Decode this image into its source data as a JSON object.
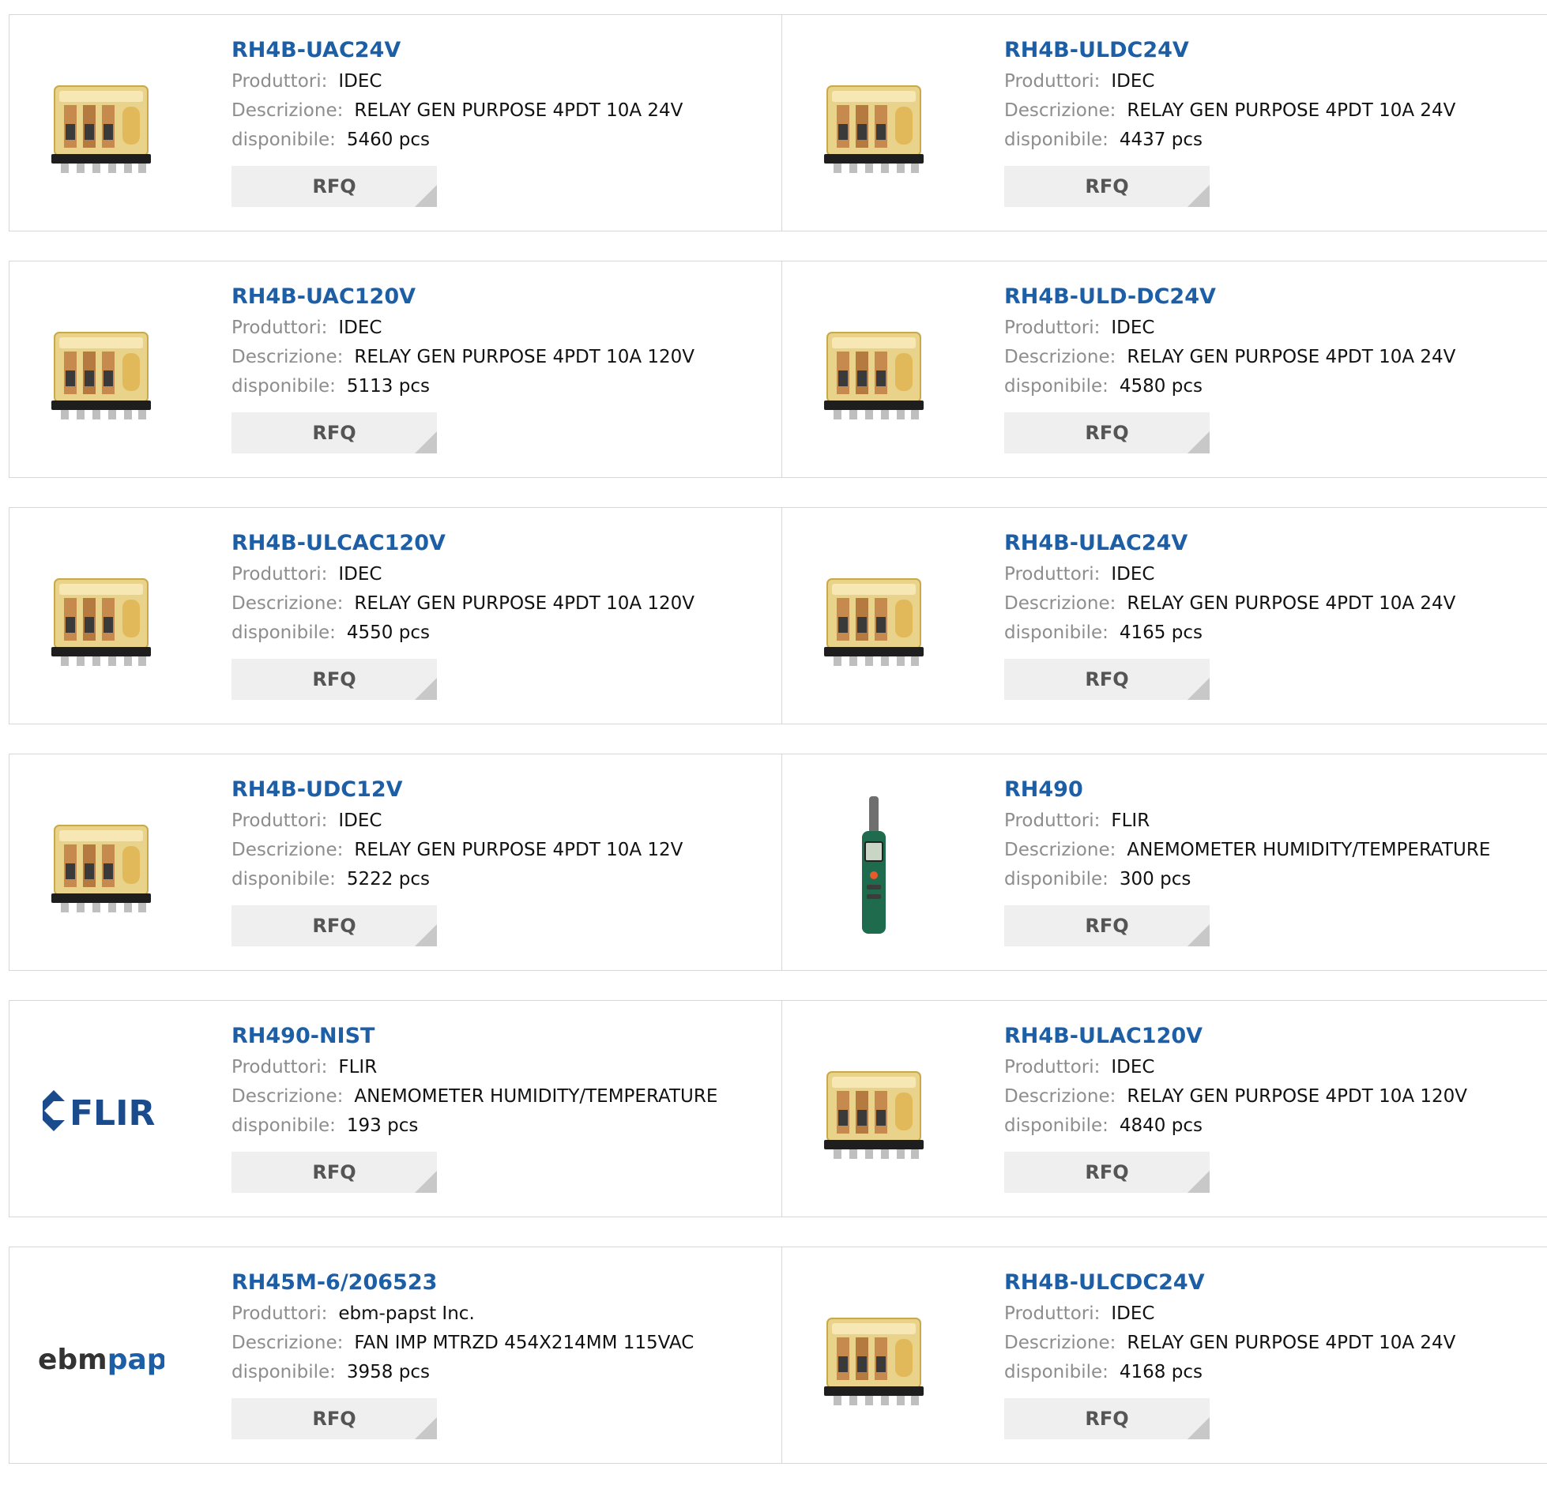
{
  "labels": {
    "manufacturer": "Produttori:",
    "description": "Descrizione:",
    "available": "disponibile:",
    "rfq": "RFQ"
  },
  "colors": {
    "part_link": "#1d5fa7",
    "label_gray": "#8d8d8d",
    "rfq_bg": "#efefef",
    "border": "#d7d7d7"
  },
  "rows": [
    [
      {
        "part": "RH4B-UAC24V",
        "manufacturer": "IDEC",
        "description": "RELAY GEN PURPOSE 4PDT 10A 24V",
        "stock": "5460 pcs",
        "image": "relay"
      },
      {
        "part": "RH4B-ULDC24V",
        "manufacturer": "IDEC",
        "description": "RELAY GEN PURPOSE 4PDT 10A 24V",
        "stock": "4437 pcs",
        "image": "relay"
      }
    ],
    [
      {
        "part": "RH4B-UAC120V",
        "manufacturer": "IDEC",
        "description": "RELAY GEN PURPOSE 4PDT 10A 120V",
        "stock": "5113 pcs",
        "image": "relay"
      },
      {
        "part": "RH4B-ULD-DC24V",
        "manufacturer": "IDEC",
        "description": "RELAY GEN PURPOSE 4PDT 10A 24V",
        "stock": "4580 pcs",
        "image": "relay"
      }
    ],
    [
      {
        "part": "RH4B-ULCAC120V",
        "manufacturer": "IDEC",
        "description": "RELAY GEN PURPOSE 4PDT 10A 120V",
        "stock": "4550 pcs",
        "image": "relay"
      },
      {
        "part": "RH4B-ULAC24V",
        "manufacturer": "IDEC",
        "description": "RELAY GEN PURPOSE 4PDT 10A 24V",
        "stock": "4165 pcs",
        "image": "relay"
      }
    ],
    [
      {
        "part": "RH4B-UDC12V",
        "manufacturer": "IDEC",
        "description": "RELAY GEN PURPOSE 4PDT 10A 12V",
        "stock": "5222 pcs",
        "image": "relay"
      },
      {
        "part": "RH490",
        "manufacturer": "FLIR",
        "description": "ANEMOMETER HUMIDITY/TEMPERATURE",
        "stock": "300 pcs",
        "image": "meter"
      }
    ],
    [
      {
        "part": "RH490-NIST",
        "manufacturer": "FLIR",
        "description": "ANEMOMETER HUMIDITY/TEMPERATURE",
        "stock": "193 pcs",
        "image": "flir-logo",
        "logo_text": "FLIR"
      },
      {
        "part": "RH4B-ULAC120V",
        "manufacturer": "IDEC",
        "description": "RELAY GEN PURPOSE 4PDT 10A 120V",
        "stock": "4840 pcs",
        "image": "relay"
      }
    ],
    [
      {
        "part": "RH45M-6/206523",
        "manufacturer": "ebm-papst Inc.",
        "description": "FAN IMP MTRZD 454X214MM 115VAC",
        "stock": "3958 pcs",
        "image": "ebmpapst-logo",
        "logo_text_a": "ebm",
        "logo_text_b": "papst"
      },
      {
        "part": "RH4B-ULCDC24V",
        "manufacturer": "IDEC",
        "description": "RELAY GEN PURPOSE 4PDT 10A 24V",
        "stock": "4168 pcs",
        "image": "relay"
      }
    ]
  ]
}
